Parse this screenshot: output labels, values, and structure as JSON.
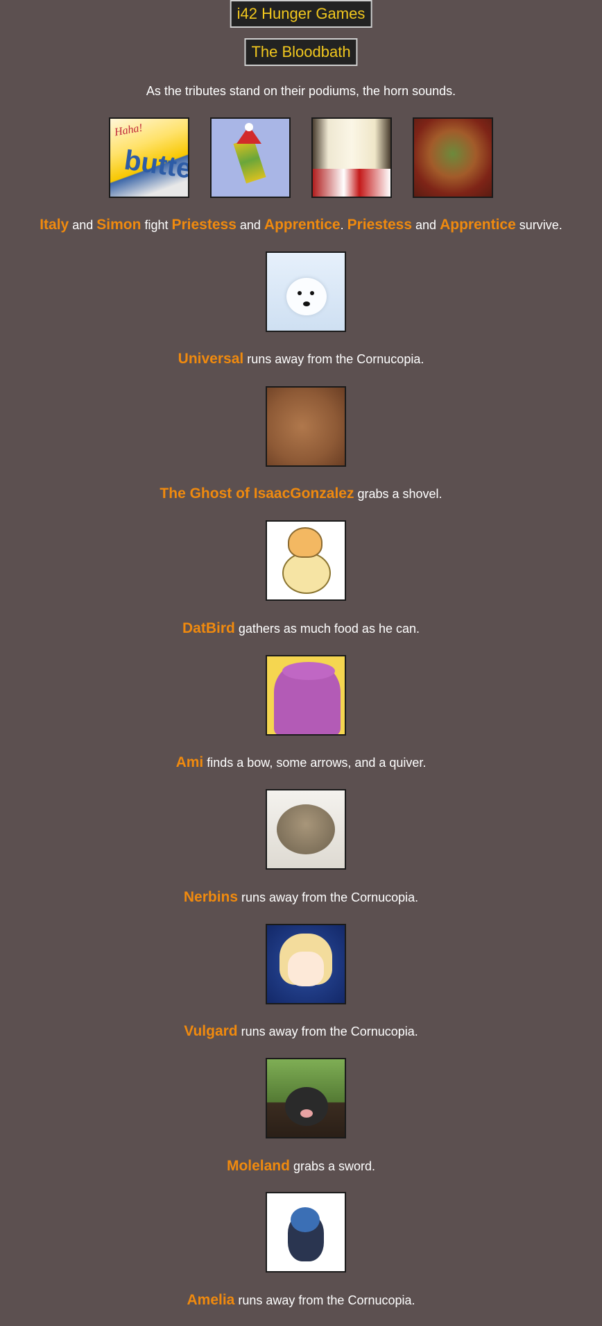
{
  "header": {
    "title": "i42 Hunger Games",
    "subtitle": "The Bloodbath"
  },
  "intro": "As the tributes stand on their podiums, the horn sounds.",
  "group_event": {
    "avatars": [
      "butter-avatar",
      "minecraft-santa-avatar",
      "white-haired-anime-avatar",
      "red-armored-anime-avatar"
    ],
    "name1": "Italy",
    "t1": " and ",
    "name2": "Simon",
    "t2": " fight ",
    "name3": "Priestess",
    "t3": " and ",
    "name4": "Apprentice",
    "t4": ". ",
    "name5": "Priestess",
    "t5": " and ",
    "name6": "Apprentice",
    "t6": " survive."
  },
  "events": [
    {
      "avatar": "polar-bear-avatar",
      "name": "Universal",
      "text": " runs away from the Cornucopia."
    },
    {
      "avatar": "skin-closeup-avatar",
      "name": "The Ghost of IsaacGonzalez",
      "text": " grabs a shovel."
    },
    {
      "avatar": "duck-avatar",
      "name": "DatBird",
      "text": " gathers as much food as he can."
    },
    {
      "avatar": "purple-character-avatar",
      "name": "Ami",
      "text": " finds a bow, some arrows, and a quiver."
    },
    {
      "avatar": "frog-avatar",
      "name": "Nerbins",
      "text": " runs away from the Cornucopia."
    },
    {
      "avatar": "blonde-knight-avatar",
      "name": "Vulgard",
      "text": " runs away from the Cornucopia."
    },
    {
      "avatar": "mole-avatar",
      "name": "Moleland",
      "text": " grabs a sword."
    },
    {
      "avatar": "chibi-knight-avatar",
      "name": "Amelia",
      "text": " runs away from the Cornucopia."
    }
  ]
}
